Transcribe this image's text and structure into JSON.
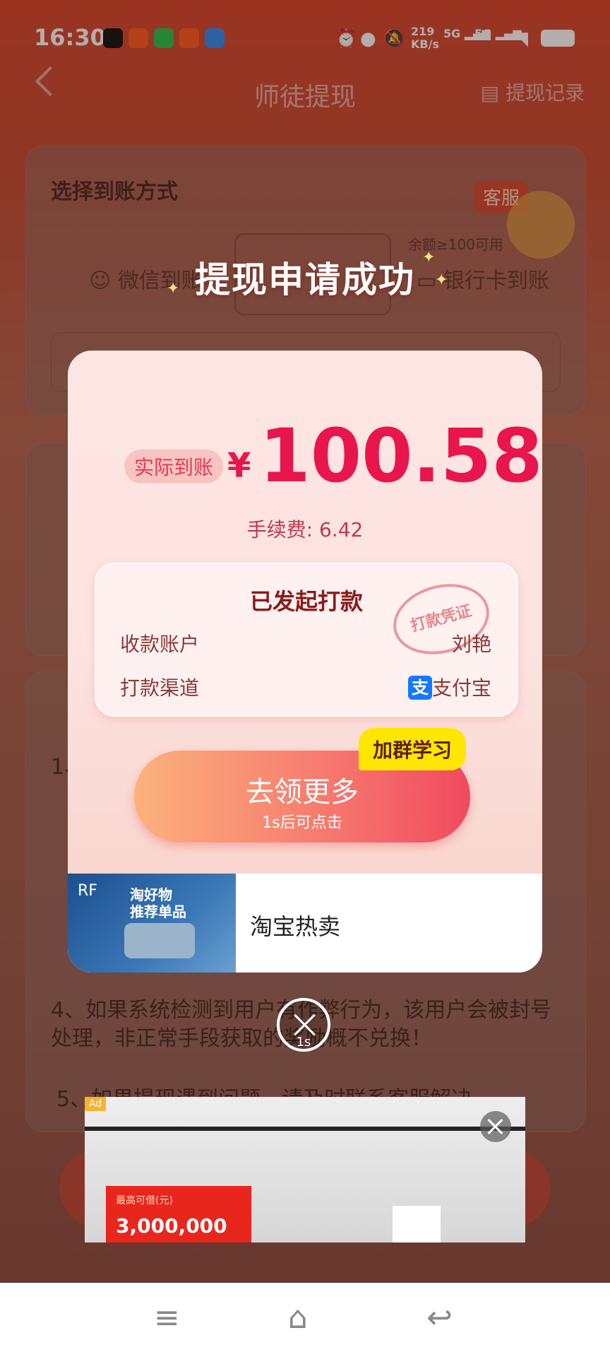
{
  "status_bar": {
    "time": "16:30",
    "network_speed": "219\nKB/s",
    "net1": "5G",
    "net2": "5G"
  },
  "header": {
    "title": "师徒提现",
    "records": "提现记录"
  },
  "background": {
    "method_title": "选择到账方式",
    "customer_service": "客服",
    "wechat": "微信到账",
    "bank_note": "余额≥100可用",
    "bank": "银行卡到账",
    "tip_1": "1、",
    "tip_4": "4、如果系统检测到用户有作弊行为，该用户会被封号处理，非正常手段获取的奖励概不兑换！",
    "tip_5": "5、如果提现遇到问题，请及时联系客服解决。"
  },
  "dialog": {
    "title": "提现申请成功",
    "actual_label": "实际到账",
    "currency": "¥",
    "amount": "100.58",
    "fee": "手续费: 6.42",
    "card_title": "已发起打款",
    "stamp": "打款凭证",
    "account_label": "收款账户",
    "account_value": "刘艳",
    "channel_label": "打款渠道",
    "channel_value": "支付宝",
    "join_tag": "加群学习",
    "cta_label": "去领更多",
    "cta_sub": "1s后可点击"
  },
  "ad_inline": {
    "badge": "RF",
    "thumb_text": "淘好物\n推荐单品",
    "title": "淘宝热卖"
  },
  "close_countdown": "1s",
  "ad_bottom": {
    "badge": "Ad",
    "amount_label": "最高可借(元)",
    "amount": "3,000,000"
  }
}
